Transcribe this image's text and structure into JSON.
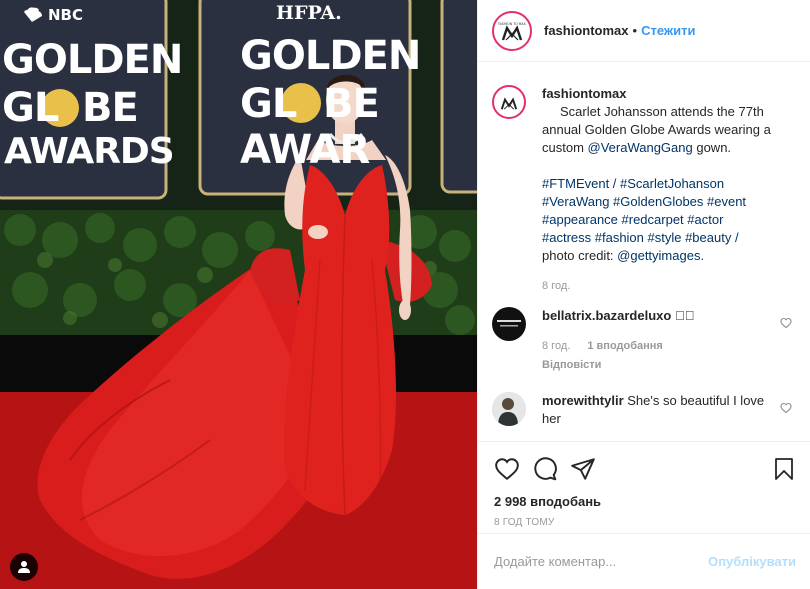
{
  "photo": {
    "board_left": {
      "lines": [
        "GOLDEN",
        "GL",
        "BE",
        "AWARDS"
      ],
      "network": "NBC"
    },
    "board_center": {
      "lines": [
        "GOLDEN",
        "GL",
        "BE",
        "AWAR"
      ],
      "network": "HFPA."
    },
    "tag_icon": "user-tag-icon"
  },
  "header": {
    "username": "fashiontomax",
    "separator": "•",
    "follow_label": "Стежити",
    "avatar_text": "FASHION TO MAX"
  },
  "caption": {
    "username": "fashiontomax",
    "text_1": "Scarlet Johansson attends the 77th annual Golden Globe Awards wearing a custom ",
    "mention": "@VeraWangGang",
    "text_2": " gown.",
    "tags_1": "#FTMEvent / #ScarletJohanson",
    "tags_2": "#VeraWang #GoldenGlobes #event",
    "tags_3": "#appearance #redcarpet #actor",
    "tags_4": "#actress #fashion #style #beauty /",
    "credit_prefix": "photo credit: ",
    "credit_mention": "@gettyimages.",
    "time": "8 год."
  },
  "comments": [
    {
      "username": "bellatrix.bazardeluxo",
      "text": "⃞⃞",
      "time": "8 год.",
      "likes": "1 вподобання",
      "reply": "Відповісти"
    },
    {
      "username": "morewithtylir",
      "text": "She's so beautiful I love her"
    }
  ],
  "actions": {
    "like_count": "2 998 вподобань",
    "timestamp": "8 ГОД ТОМУ"
  },
  "comment_input": {
    "placeholder": "Додайте коментар...",
    "publish_label": "Опублікувати"
  },
  "colors": {
    "link": "#003569",
    "follow": "#3897f0",
    "publish_disabled": "#b2dffc",
    "dress": "#e0221f",
    "carpet": "#c21616"
  }
}
